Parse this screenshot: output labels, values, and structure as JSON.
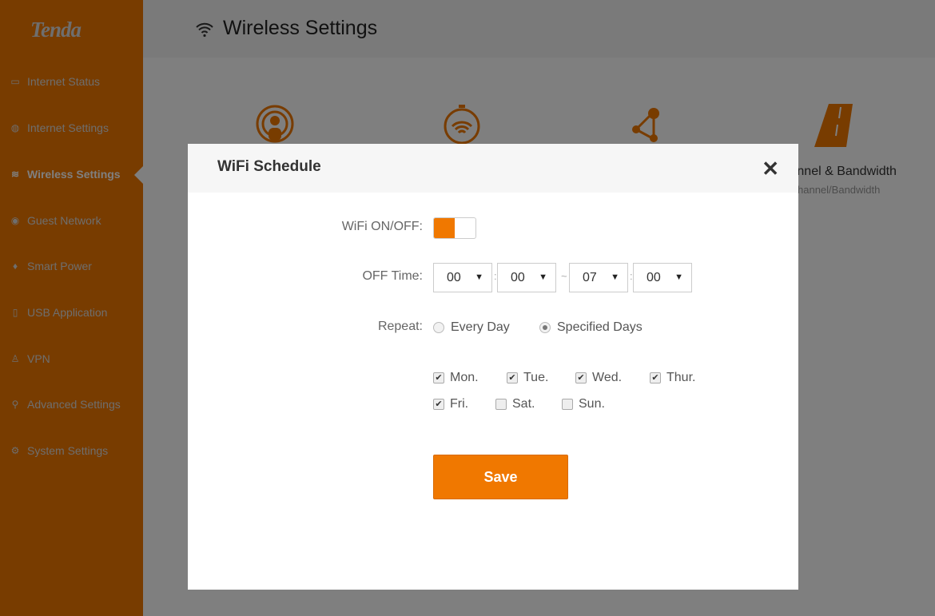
{
  "brand": "Tenda",
  "sidebar": {
    "items": [
      {
        "label": "Internet Status",
        "icon": "monitor-icon"
      },
      {
        "label": "Internet Settings",
        "icon": "globe-icon"
      },
      {
        "label": "Wireless Settings",
        "icon": "wifi-icon",
        "active": true
      },
      {
        "label": "Guest Network",
        "icon": "guest-icon"
      },
      {
        "label": "Smart Power",
        "icon": "leaf-icon"
      },
      {
        "label": "USB Application",
        "icon": "usb-icon"
      },
      {
        "label": "VPN",
        "icon": "vpn-icon"
      },
      {
        "label": "Advanced Settings",
        "icon": "wrench-icon"
      },
      {
        "label": "System Settings",
        "icon": "gear-icon"
      }
    ]
  },
  "header": {
    "title": "Wireless Settings"
  },
  "features": [
    {
      "icon": "wifi-name-icon"
    },
    {
      "icon": "wifi-schedule-icon"
    },
    {
      "icon": "wps-icon"
    },
    {
      "icon": "road-icon",
      "title": "Channel & Bandwidth",
      "subtitle": "Channel/Bandwidth"
    }
  ],
  "modal": {
    "title": "WiFi Schedule",
    "wifi_label": "WiFi ON/OFF:",
    "wifi_on": true,
    "off_time_label": "OFF Time:",
    "off_time": {
      "start_hour": "00",
      "start_min": "00",
      "end_hour": "07",
      "end_min": "00"
    },
    "colon": ":",
    "tilde": "~",
    "repeat_label": "Repeat:",
    "repeat_options": [
      {
        "label": "Every Day",
        "selected": false
      },
      {
        "label": "Specified Days",
        "selected": true
      }
    ],
    "days": [
      {
        "label": "Mon.",
        "checked": true
      },
      {
        "label": "Tue.",
        "checked": true
      },
      {
        "label": "Wed.",
        "checked": true
      },
      {
        "label": "Thur.",
        "checked": true
      },
      {
        "label": "Fri.",
        "checked": true
      },
      {
        "label": "Sat.",
        "checked": false
      },
      {
        "label": "Sun.",
        "checked": false
      }
    ],
    "save_label": "Save"
  },
  "colors": {
    "accent": "#f07800"
  }
}
